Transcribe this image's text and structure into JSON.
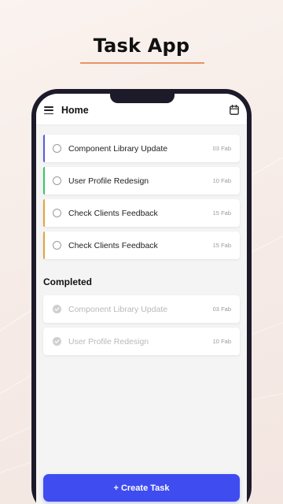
{
  "headline": "Task App",
  "appbar": {
    "title": "Home"
  },
  "tasks": [
    {
      "title": "Component Library Update",
      "date": "03 Fab",
      "accent": "#5b5bd6"
    },
    {
      "title": "User Profile Redesign",
      "date": "10 Fab",
      "accent": "#3cc46a"
    },
    {
      "title": "Check Clients Feedback",
      "date": "15 Fab",
      "accent": "#e0a43a"
    },
    {
      "title": "Check Clients Feedback",
      "date": "15 Fab",
      "accent": "#e0a43a"
    }
  ],
  "completed": {
    "title": "Completed",
    "items": [
      {
        "title": "Component Library Update",
        "date": "03 Fab"
      },
      {
        "title": "User Profile Redesign",
        "date": "10 Fab"
      }
    ]
  },
  "create_button": {
    "label": "+ Create Task"
  },
  "colors": {
    "primary": "#3f4cf0",
    "headline_underline": "#e79566",
    "phone_frame": "#1d1b2a"
  },
  "icons": {
    "menu": "menu-icon",
    "calendar": "calendar-icon",
    "checkbox": "circle-outline-icon",
    "completed": "check-circle-icon"
  }
}
